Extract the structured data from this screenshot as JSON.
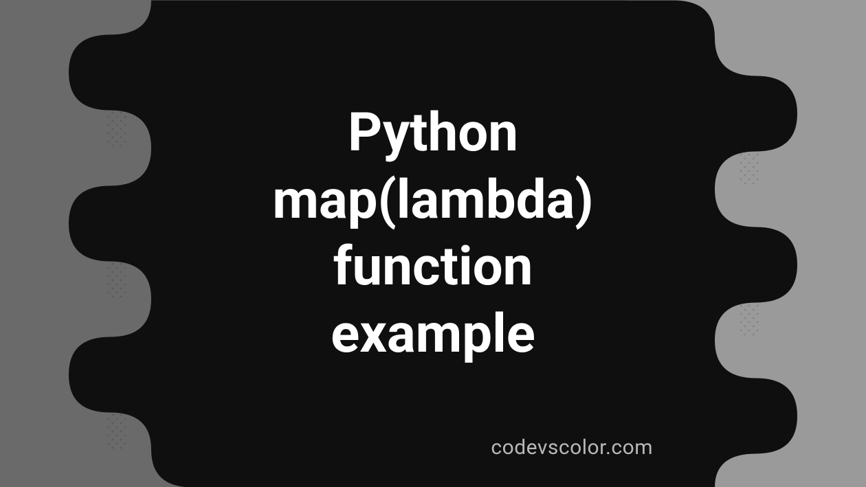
{
  "title_lines": "Python\nmap(lambda)\nfunction\nexample",
  "footer": "codevscolor.com",
  "colors": {
    "blob": "#0f0f0f",
    "bg_left": "#6a6a6a",
    "bg_right": "#9a9a9a",
    "text": "#ffffff",
    "footer_text": "#b8b8b8"
  }
}
